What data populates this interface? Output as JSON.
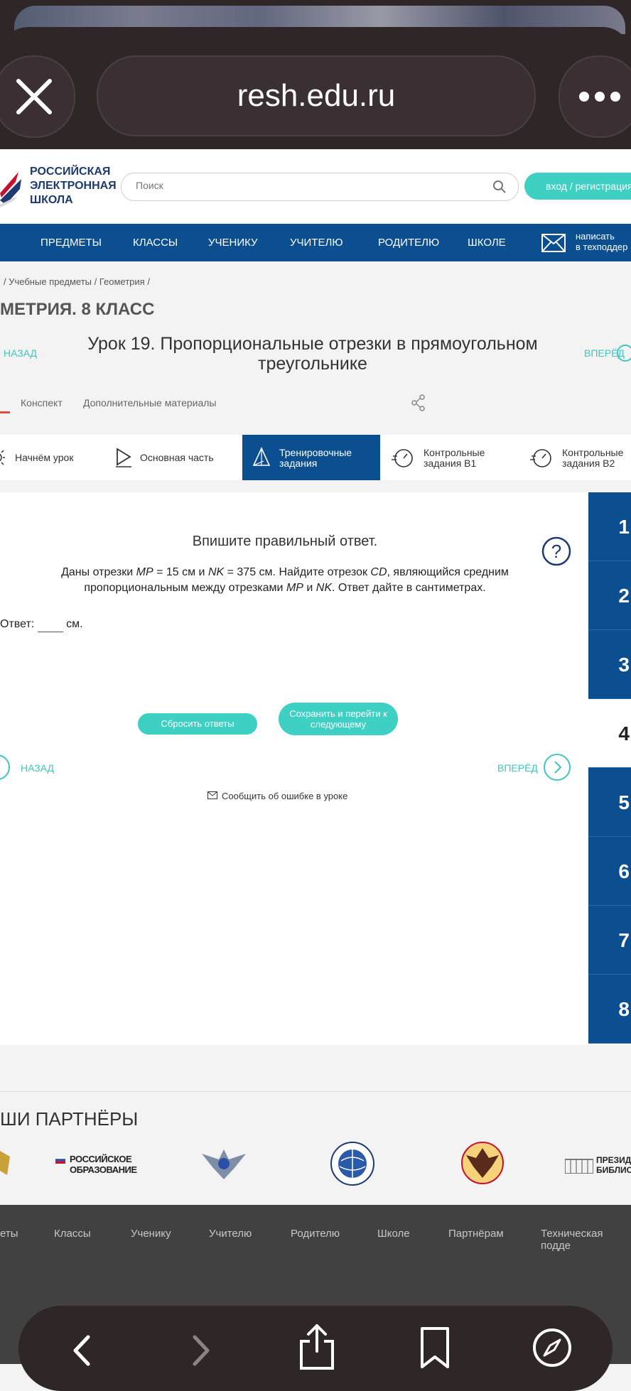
{
  "browser": {
    "url": "resh.edu.ru"
  },
  "header": {
    "logo_lines": [
      "РОССИЙСКАЯ",
      "ЭЛЕКТРОННАЯ",
      "ШКОЛА"
    ],
    "search_placeholder": "Поиск",
    "login_label": "вход / регистрация"
  },
  "nav": {
    "items": [
      "ПРЕДМЕТЫ",
      "КЛАССЫ",
      "УЧЕНИКУ",
      "УЧИТЕЛЮ",
      "РОДИТЕЛЮ",
      "ШКОЛЕ"
    ],
    "support_line1": "написать",
    "support_line2": "в техподдер"
  },
  "breadcrumb": {
    "items": [
      "Учебные предметы",
      "Геометрия"
    ]
  },
  "course_title": "МЕТРИЯ. 8 КЛАСС",
  "lesson": {
    "back_label": "НАЗАД",
    "forward_label": "ВПЕРЁД",
    "title": "Урок 19. Пропорциональные отрезки в прямоугольном треугольнике"
  },
  "content_tabs": [
    "Конспект",
    "Дополнительные материалы"
  ],
  "steps": [
    {
      "label": "Начнём урок"
    },
    {
      "label": "Основная часть"
    },
    {
      "label": "Тренировочные задания",
      "line1": "Тренировочные",
      "line2": "задания"
    },
    {
      "label": "Контрольные задания В1",
      "line1": "Контрольные",
      "line2": "задания В1"
    },
    {
      "label": "Контрольные задания В2",
      "line1": "Контрольные",
      "line2": "задания В2"
    }
  ],
  "task": {
    "instruction": "Впишите правильный ответ.",
    "text_parts": [
      "Даны отрезки ",
      "MP",
      " = 15 см и ",
      "NK",
      " = 375 см. Найдите отрезок ",
      "CD",
      ", являющийся средним",
      "пропорциональным между отрезками ",
      "MP",
      " и ",
      "NK",
      ". Ответ дайте в сантиметрах."
    ],
    "answer_label": "Ответ:",
    "answer_unit": "см.",
    "answer_value": "",
    "reset_label": "Сбросить ответы",
    "save_line1": "Сохранить и перейти к",
    "save_line2": "следующему",
    "back_label": "НАЗАД",
    "forward_label": "ВПЕРЁД",
    "report_label": "Сообщить об ошибке в уроке"
  },
  "task_numbers": [
    "1",
    "2",
    "3",
    "4",
    "5",
    "6",
    "7",
    "8"
  ],
  "active_task": "4",
  "partners": {
    "title": "ШИ ПАРТНЁРЫ",
    "logo_text_1_line1": "РОССИЙСКОЕ",
    "logo_text_1_line2": "ОБРАЗОВАНИЕ",
    "logo_text_2_line1": "ПРЕЗИДЕ",
    "logo_text_2_line2": "БИБЛИС"
  },
  "footer": {
    "links": [
      "еты",
      "Классы",
      "Ученику",
      "Учителю",
      "Родителю",
      "Школе",
      "Партнёрам",
      "Техническая подде"
    ]
  },
  "colors": {
    "brand_blue": "#0b4f90",
    "accent_teal": "#3dd0c3",
    "browser_dark": "#2f2628"
  }
}
